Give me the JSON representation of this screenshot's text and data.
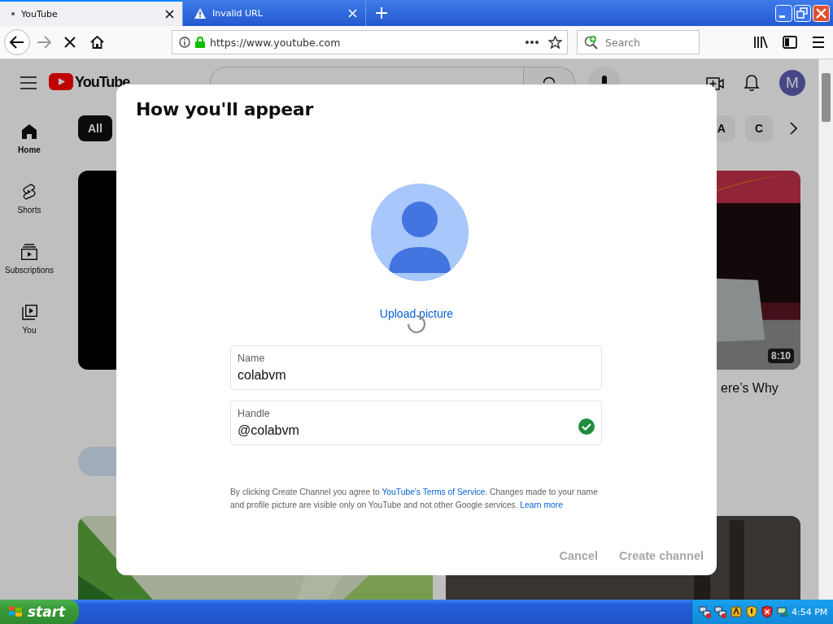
{
  "browser": {
    "tabs": [
      {
        "title": "YouTube",
        "selected": true
      },
      {
        "title": "Invalid URL",
        "selected": false
      }
    ],
    "url": "https://www.youtube.com",
    "search_placeholder": "Search"
  },
  "youtube": {
    "logo_text": "YouTube",
    "avatar_letter": "M",
    "sidebar": [
      {
        "label": "Home",
        "selected": true
      },
      {
        "label": "Shorts",
        "selected": false
      },
      {
        "label": "Subscriptions",
        "selected": false
      },
      {
        "label": "You",
        "selected": false
      }
    ],
    "chips": [
      {
        "label": "All",
        "selected": true
      },
      {
        "label": "A",
        "selected": false
      },
      {
        "label": "C",
        "selected": false
      }
    ],
    "videos": [
      {
        "kind": "blank"
      },
      {
        "kind": "picture",
        "duration": "8:10",
        "title": "ere’s Why"
      },
      {
        "kind": "picture"
      },
      {
        "kind": "picture"
      }
    ]
  },
  "dialog": {
    "title": "How you'll appear",
    "upload": "Upload picture",
    "fields": [
      {
        "label": "Name",
        "value": "colabvm",
        "valid": false
      },
      {
        "label": "Handle",
        "value": "@colabvm",
        "valid": true
      }
    ],
    "terms": {
      "before": "By clicking Create Channel you agree to ",
      "link": "YouTube's Terms of Service",
      "after": ". Changes made to your name and profile picture are visible only on YouTube and not other Google services. ",
      "learn_more": "Learn more"
    },
    "buttons": [
      {
        "label": "Cancel",
        "disabled": true
      },
      {
        "label": "Create channel",
        "disabled": true
      }
    ]
  },
  "taskbar": {
    "start": "start",
    "clock": "4:54 PM"
  }
}
